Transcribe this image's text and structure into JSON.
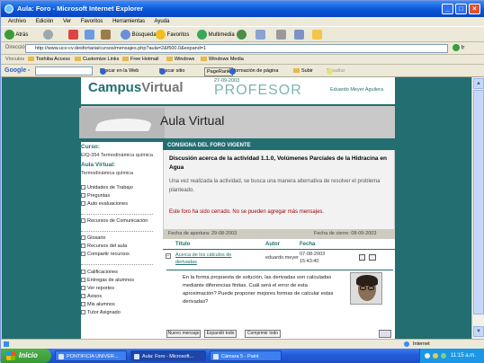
{
  "window": {
    "title": "Aula: Foro - Microsoft Internet Explorer"
  },
  "menu": [
    "Archivo",
    "Edición",
    "Ver",
    "Favoritos",
    "Herramientas",
    "Ayuda"
  ],
  "toolbar": {
    "back": "Atrás",
    "search": "Búsqueda",
    "favorites": "Favoritos",
    "multimedia": "Multimedia"
  },
  "address": {
    "label": "Dirección",
    "url": "http://www.ucv-cv.desfortaria/cursos/mensajes.php?aula=2&f500.0&expand=1",
    "go": "Ir"
  },
  "links": {
    "label": "Vínculos",
    "items": [
      "Toshiba Access",
      "Customize Links",
      "Free Hotmail",
      "Windows",
      "Windows Media"
    ]
  },
  "google": {
    "label": "Google -",
    "search": "Buscar en la Web",
    "search_site": "Buscar sitio",
    "pagerank": "PageRank",
    "page_info": "Información de página",
    "up": "Subir",
    "highlight": "Resaltar"
  },
  "site": {
    "brand_a": "Campus",
    "brand_b": "Virtual",
    "date": "27-09-2003",
    "role": "PROFESOR",
    "user": "Eduardo Meyer Aguilera",
    "banner": "Aula Virtual"
  },
  "sidebar": {
    "curso_label": "Curso:",
    "curso_value": "EIQ-354 Termodinámica química",
    "aula_label": "Aula Virtual:",
    "aula_value": "Termodinámica química",
    "group1": [
      "Unidades de Trabajo",
      "Preguntas",
      "Auto evaluaciones"
    ],
    "group2": [
      "Recursos de Comunicación"
    ],
    "group3": [
      "Glosario",
      "Recursos del aula",
      "Compartir recursos"
    ],
    "group4": [
      "Calificaciones",
      "Entregas de alumnos",
      "Ver reportes",
      "Avisos",
      "Mis alumnos",
      "Tutor Asignado"
    ]
  },
  "forum": {
    "header": "CONSIGNA DEL FORO VIGENTE",
    "title": "Discusión acerca de la actividad 1.1.0, Volúmenes Parciales de la Hidracina en Agua",
    "description": "Una vez realizada la actividad, se busca una manera alternativa de resolver el problema planteado.",
    "closed": "Este foro ha sido cerrado. No se pueden agregar más mensajes.",
    "open_date": "Fecha de apertura: 29-08-2003",
    "close_date": "Fecha de cierre: 08-09-2003",
    "col_title": "Título",
    "col_author": "Autor",
    "col_date": "Fecha",
    "row_title": "Acerca de los cálculos de derivadas",
    "row_author": "eduardo.meyer",
    "row_date": "07-08-2003",
    "row_time": "15:43:40",
    "message": "En la forma propuesta de solución, las derivadas son calculadas mediante diferencias finitas. Cuál será el error de esta aproximación? Puede proponer mejores formas de calcular estas derivadas?",
    "buttons": [
      "Nuevo mensaje",
      "Expandir todo",
      "Comprimir todo"
    ]
  },
  "statusbar": {
    "zone": "Internet"
  },
  "taskbar": {
    "start": "Inicio",
    "tasks": [
      "PONTIFICIA UNIVER...",
      "Aula: Foro - Microsoft...",
      "Cámara 5 - Paint"
    ],
    "clock": "11:15 a.m."
  }
}
